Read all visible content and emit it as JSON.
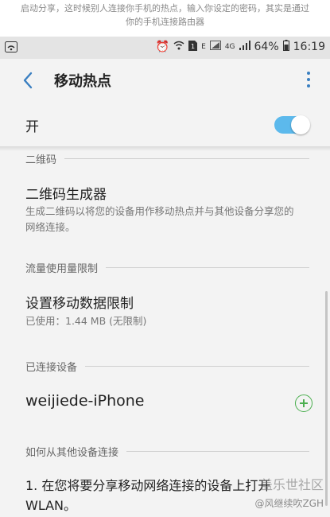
{
  "caption": {
    "line1": "启动分享，这时候别人连接你手机的热点，输入你设定的密码，其实是通过",
    "line2": "你的手机连接路由器"
  },
  "status_bar": {
    "net_label": "E",
    "lte_label": "4G",
    "battery": "64%",
    "time": "16:19"
  },
  "appbar": {
    "title": "移动热点"
  },
  "toggle": {
    "label": "开",
    "on": true
  },
  "sections": {
    "qr": {
      "header": "二维码",
      "title": "二维码生成器",
      "desc": "生成二维码以将您的设备用作移动热点并与其他设备分享您的网络连接。"
    },
    "data_limit": {
      "header": "流量使用量限制",
      "title": "设置移动数据限制",
      "desc": "已使用：1.44 MB (无限制)"
    },
    "connected": {
      "header": "已连接设备",
      "device": "weijiede-iPhone"
    },
    "howto": {
      "header": "如何从其他设备连接",
      "step1": "1. 在您将要分享移动网络连接的设备上打开 WLAN。"
    }
  },
  "watermark": {
    "line1": "盖乐世社区",
    "line2": "@风继续吹ZGH"
  },
  "colors": {
    "accent": "#5cb9ec",
    "add": "#4caf50",
    "back": "#3a7fc1"
  }
}
